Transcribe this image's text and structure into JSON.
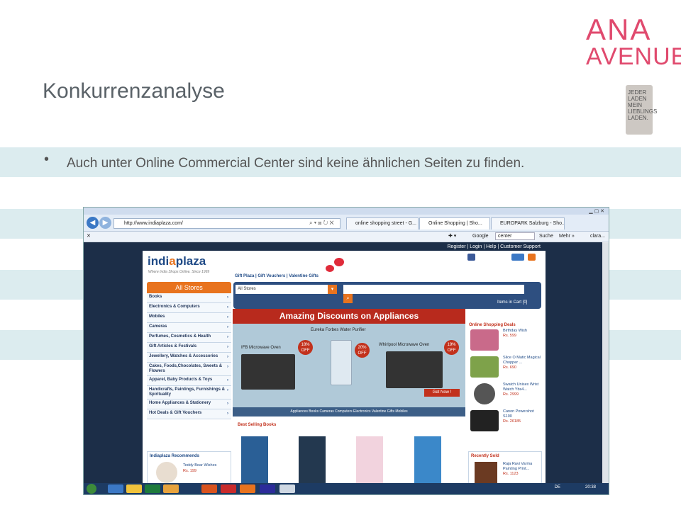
{
  "slide": {
    "title": "Konkurrenzanalyse",
    "bullet": "Auch unter Online Commercial Center sind keine ähnlichen Seiten zu finden."
  },
  "logo": {
    "line1": "ANA",
    "line2": "AVENUE",
    "tag_lines": [
      "JEDER LADEN",
      "MEIN",
      "LIEBLINGS",
      "LADEN."
    ],
    "color": "#e04a6e"
  },
  "browser": {
    "address": "http://www.indiaplaza.com/",
    "tabs": [
      "online shopping street - G...",
      "Online Shopping | Sho...",
      "EUROPARK Salzburg - Sho..."
    ],
    "google_label": "Google",
    "google_value": "center",
    "search_label": "Suche",
    "more_label": "Mehr »",
    "user_label": "clara...",
    "taskbar_lang": "DE",
    "clock": "20:38"
  },
  "site": {
    "top_links": "Register | Login | Help | Customer Support",
    "logo_pre": "indi",
    "logo_a": "a",
    "logo_post": "plaza",
    "tagline": "Where India Shops Online. Since 1999",
    "gift_links": "Gift Plaza | Gift Vouchers | Valentine Gifts",
    "search_select": "All Stores",
    "cart_label": "Items in Cart [0]",
    "stores_heading": "All Stores",
    "stores": [
      "Books",
      "Electronics & Computers",
      "Mobiles",
      "Cameras",
      "Perfumes, Cosmetics & Health",
      "Gift Articles & Festivals",
      "Jewellery, Watches & Accessories",
      "Cakes, Foods,Chocolates, Sweets & Flowers",
      "Apparel, Baby Products & Toys",
      "Handicrafts, Paintings, Furnishings & Spirituality",
      "Home Appliances & Stationery",
      "Hot Deals & Gift Vouchers"
    ],
    "banner": {
      "heading": "Amazing Discounts on Appliances",
      "item1": "IFB Microwave Oven",
      "item1_off": "18%",
      "item2": "Eureka Forbes Water Purifier",
      "item2_off": "20%",
      "item3": "Whirlpool Microwave Oven",
      "item3_off": "19%",
      "off_label": "OFF",
      "cta": "Get Now !",
      "nav": "Appliances Books Cameras Computers Electronics Valentine Gifts Mobiles"
    },
    "deals_heading": "Online Shopping Deals",
    "deals": [
      {
        "name": "Birthday Wish",
        "price": "Rs. 599"
      },
      {
        "name": "Slice O Matic Magical Chopper ...",
        "price": "Rs. 690"
      },
      {
        "name": "Swatch Unisex Wrist Watch Ybs4...",
        "price": "Rs. 2999"
      },
      {
        "name": "Canon Powershot S100",
        "price": "Rs. 26185"
      }
    ],
    "books_heading": "Best Selling Books",
    "recommends_heading": "Indiaplaza Recommends",
    "recommend_item": "Teddy Bear Wishes",
    "recommend_price": "Rs. 199",
    "recently_heading": "Recently Sold",
    "recently_item": "Raja Ravi Varma Painting Print...",
    "recently_price": "Rs. 1123"
  }
}
